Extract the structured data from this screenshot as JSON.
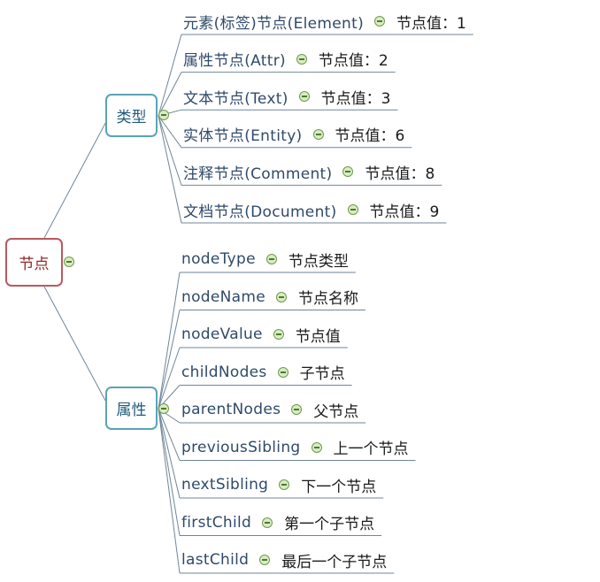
{
  "root": {
    "label": "节点"
  },
  "groups": [
    {
      "label": "类型",
      "items": [
        {
          "text": "元素(标签)节点(Element)",
          "value": "节点值：1"
        },
        {
          "text": "属性节点(Attr)",
          "value": "节点值：2"
        },
        {
          "text": "文本节点(Text)",
          "value": "节点值：3"
        },
        {
          "text": "实体节点(Entity)",
          "value": "节点值：6"
        },
        {
          "text": "注释节点(Comment)",
          "value": "节点值：8"
        },
        {
          "text": "文档节点(Document)",
          "value": "节点值：9"
        }
      ]
    },
    {
      "label": "属性",
      "items": [
        {
          "text": "nodeType",
          "value": "节点类型"
        },
        {
          "text": "nodeName",
          "value": "节点名称"
        },
        {
          "text": "nodeValue",
          "value": "节点值"
        },
        {
          "text": "childNodes",
          "value": "子节点"
        },
        {
          "text": "parentNodes",
          "value": "父节点"
        },
        {
          "text": "previousSibling",
          "value": "上一个节点"
        },
        {
          "text": "nextSibling",
          "value": "下一个节点"
        },
        {
          "text": "firstChild",
          "value": "第一个子节点"
        },
        {
          "text": "lastChild",
          "value": "最后一个子节点"
        }
      ]
    }
  ]
}
